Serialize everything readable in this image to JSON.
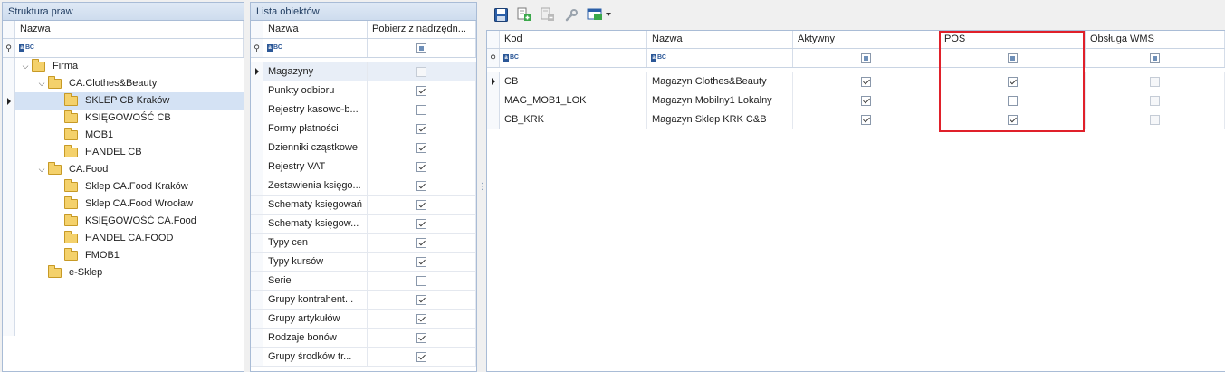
{
  "left_panel": {
    "title": "Struktura praw",
    "column": "Nazwa",
    "tree": [
      {
        "label": "Firma",
        "level": 0,
        "expanded": true
      },
      {
        "label": "CA.Clothes&Beauty",
        "level": 1,
        "expanded": true
      },
      {
        "label": "SKLEP CB Kraków",
        "level": 2,
        "selected": true
      },
      {
        "label": "KSIĘGOWOŚĆ CB",
        "level": 2
      },
      {
        "label": "MOB1",
        "level": 2
      },
      {
        "label": "HANDEL CB",
        "level": 2
      },
      {
        "label": "CA.Food",
        "level": 1,
        "expanded": true
      },
      {
        "label": "Sklep CA.Food Kraków",
        "level": 2
      },
      {
        "label": "Sklep CA.Food Wrocław",
        "level": 2
      },
      {
        "label": "KSIĘGOWOŚĆ CA.Food",
        "level": 2
      },
      {
        "label": "HANDEL CA.FOOD",
        "level": 2
      },
      {
        "label": "FMOB1",
        "level": 2
      },
      {
        "label": "e-Sklep",
        "level": 1
      }
    ]
  },
  "middle_panel": {
    "title": "Lista obiektów",
    "columns": [
      "Nazwa",
      "Pobierz z nadrzędn..."
    ],
    "rows": [
      {
        "name": "Magazyny",
        "checked": false,
        "current": true
      },
      {
        "name": "Punkty odbioru",
        "checked": true
      },
      {
        "name": "Rejestry kasowo-b...",
        "checked": false
      },
      {
        "name": "Formy płatności",
        "checked": true
      },
      {
        "name": "Dzienniki cząstkowe",
        "checked": true
      },
      {
        "name": "Rejestry VAT",
        "checked": true
      },
      {
        "name": "Zestawienia księgo...",
        "checked": true
      },
      {
        "name": "Schematy księgowań",
        "checked": true
      },
      {
        "name": "Schematy księgow...",
        "checked": true
      },
      {
        "name": "Typy cen",
        "checked": true
      },
      {
        "name": "Typy kursów",
        "checked": true
      },
      {
        "name": "Serie",
        "checked": false
      },
      {
        "name": "Grupy kontrahent...",
        "checked": true
      },
      {
        "name": "Grupy artykułów",
        "checked": true
      },
      {
        "name": "Rodzaje bonów",
        "checked": true
      },
      {
        "name": "Grupy środków tr...",
        "checked": true
      }
    ]
  },
  "right_panel": {
    "toolbar": [
      "save-icon",
      "add-object-icon",
      "remove-object-icon",
      "wrench-icon",
      "layout-icon"
    ],
    "columns": [
      "Kod",
      "Nazwa",
      "Aktywny",
      "POS",
      "Obsługa WMS"
    ],
    "rows": [
      {
        "kod": "CB",
        "nazwa": "Magazyn Clothes&Beauty",
        "aktywny": true,
        "pos": true,
        "wms": false,
        "current": true
      },
      {
        "kod": "MAG_MOB1_LOK",
        "nazwa": "Magazyn Mobilny1 Lokalny",
        "aktywny": true,
        "pos": false,
        "wms": false
      },
      {
        "kod": "CB_KRK",
        "nazwa": "Magazyn Sklep KRK C&B",
        "aktywny": true,
        "pos": true,
        "wms": false
      }
    ]
  },
  "colors": {
    "highlight": "#e0202a",
    "selection": "#d4e2f4",
    "header": "#cedcee"
  }
}
